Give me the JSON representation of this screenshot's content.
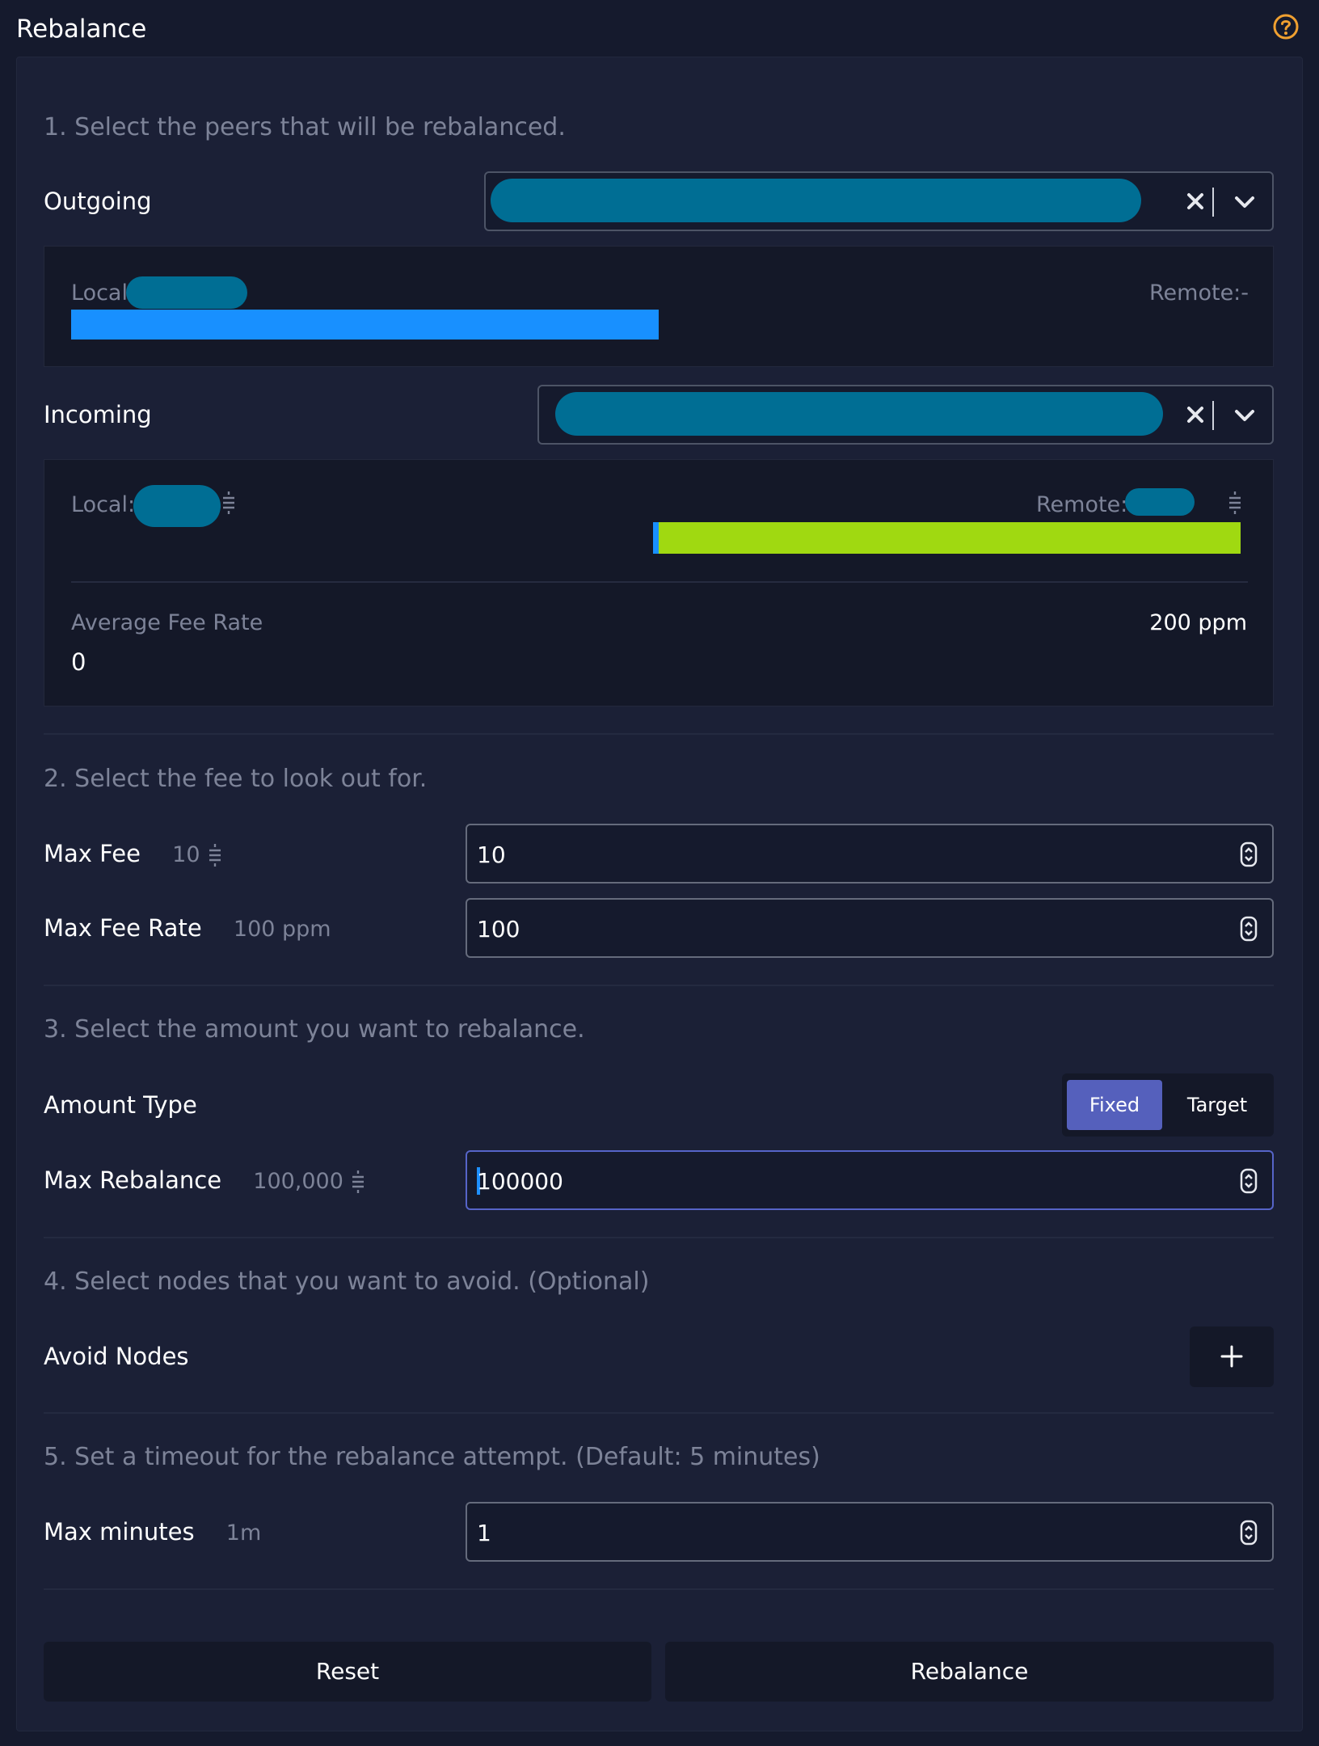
{
  "header": {
    "title": "Rebalance",
    "help_icon": "question-circle-icon",
    "help_color": "#f0a030"
  },
  "step1": {
    "title": "1. Select the peers that will be rebalanced.",
    "outgoing": {
      "label": "Outgoing",
      "local_label": "Local",
      "remote_label": "Remote:-",
      "local_ratio": 1.0,
      "local_color": "#1890ff"
    },
    "incoming": {
      "label": "Incoming",
      "local_label": "Local:",
      "remote_label": "Remote:",
      "local_ratio": 0.01,
      "local_color": "#1890ff",
      "remote_color": "#a0d911",
      "avg_fee_label": "Average Fee Rate",
      "avg_fee_value": "0",
      "fee_rate": "200 ppm"
    }
  },
  "step2": {
    "title": "2. Select the fee to look out for.",
    "max_fee": {
      "label": "Max Fee",
      "sub": "10",
      "value": "10"
    },
    "max_fee_rate": {
      "label": "Max Fee Rate",
      "sub": "100 ppm",
      "value": "100"
    }
  },
  "step3": {
    "title": "3. Select the amount you want to rebalance.",
    "amount_type": {
      "label": "Amount Type",
      "options": [
        "Fixed",
        "Target"
      ],
      "selected": "Fixed"
    },
    "max_rebalance": {
      "label": "Max Rebalance",
      "sub": "100,000",
      "value": "100000"
    }
  },
  "step4": {
    "title": "4. Select nodes that you want to avoid. (Optional)",
    "avoid_label": "Avoid Nodes"
  },
  "step5": {
    "title": "5. Set a timeout for the rebalance attempt. (Default: 5 minutes)",
    "max_minutes": {
      "label": "Max minutes",
      "sub": "1m",
      "value": "1"
    }
  },
  "actions": {
    "reset": "Reset",
    "submit": "Rebalance"
  },
  "colors": {
    "accent": "#5560bc",
    "background": "#151a2d",
    "card": "#1b2036"
  }
}
